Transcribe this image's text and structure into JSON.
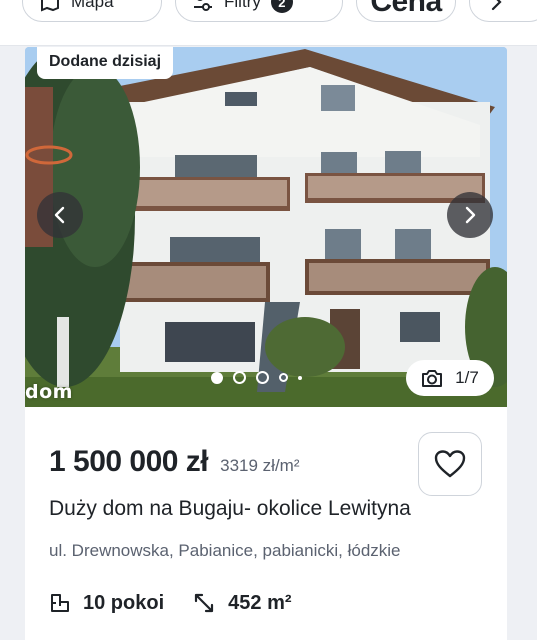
{
  "topbar": {
    "chips": [
      {
        "label": "Mapa",
        "icon": "map-icon"
      },
      {
        "label": "Filtry",
        "icon": "filters-icon",
        "count": "2"
      },
      {
        "label": "Cena"
      },
      {
        "icon": "chevron-right-icon"
      }
    ]
  },
  "listing": {
    "tag": "Dodane dzisiaj",
    "photo": {
      "counter": "1/7",
      "watermark": "dom",
      "dots_total": 5,
      "dots_active": 1
    },
    "price": "1 500 000 zł",
    "price_per_m2": "3319 zł/m²",
    "title": "Duży dom na Bugaju- okolice Lewityna",
    "address": "ul. Drewnowska, Pabianice, pabianicki, łódzkie",
    "rooms": "10 pokoi",
    "area": "452 m²"
  },
  "colors": {
    "text": "#1f2328",
    "muted": "#5b6270",
    "border": "#cfd4db",
    "background": "#eef0f4"
  }
}
